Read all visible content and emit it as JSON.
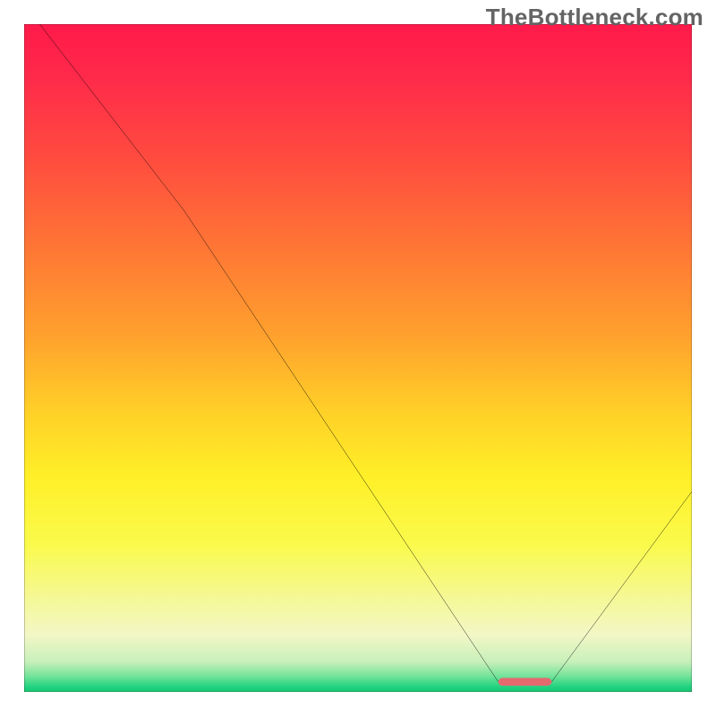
{
  "watermark": "TheBottleneck.com",
  "chart_data": {
    "type": "line",
    "title": "",
    "xlabel": "",
    "ylabel": "",
    "xlim": [
      0,
      100
    ],
    "ylim": [
      0,
      100
    ],
    "grid": false,
    "legend": false,
    "curve_points": [
      {
        "x": 0,
        "y": 103
      },
      {
        "x": 24,
        "y": 72
      },
      {
        "x": 71,
        "y": 1.5
      },
      {
        "x": 79,
        "y": 1.5
      },
      {
        "x": 100,
        "y": 30
      }
    ],
    "marker": {
      "x_start": 71,
      "x_end": 79,
      "y": 1.5,
      "color": "#e46a70",
      "rx": 2.4
    },
    "gradient_stops": [
      {
        "offset": 0.0,
        "color": "#ff1a4a"
      },
      {
        "offset": 0.08,
        "color": "#ff2a4a"
      },
      {
        "offset": 0.2,
        "color": "#ff4b3f"
      },
      {
        "offset": 0.35,
        "color": "#ff7b34"
      },
      {
        "offset": 0.47,
        "color": "#ffa22d"
      },
      {
        "offset": 0.58,
        "color": "#ffd028"
      },
      {
        "offset": 0.68,
        "color": "#fff028"
      },
      {
        "offset": 0.78,
        "color": "#fafa4c"
      },
      {
        "offset": 0.86,
        "color": "#f5f896"
      },
      {
        "offset": 0.915,
        "color": "#f2f7c6"
      },
      {
        "offset": 0.955,
        "color": "#c8f0ba"
      },
      {
        "offset": 0.975,
        "color": "#7ae49c"
      },
      {
        "offset": 0.993,
        "color": "#1fd27e"
      },
      {
        "offset": 1.0,
        "color": "#18c976"
      }
    ],
    "frame_color": "#000000",
    "frame_width": 3,
    "curve_color": "#000000",
    "curve_stroke_width": 3
  }
}
